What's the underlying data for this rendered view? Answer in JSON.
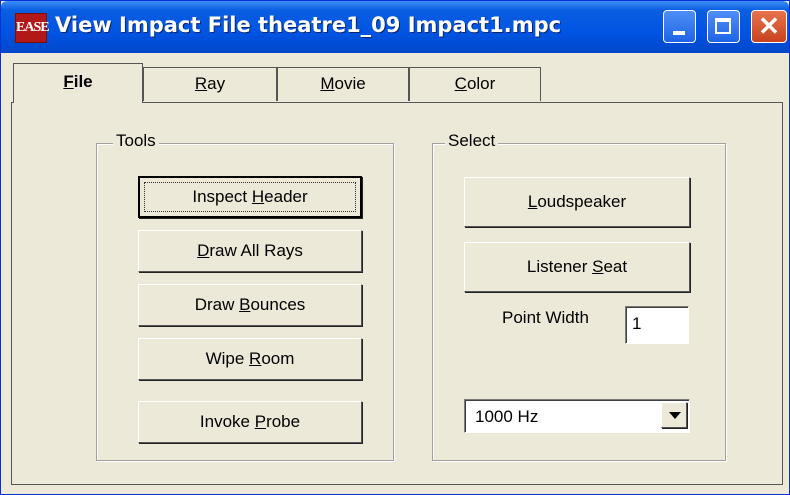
{
  "window": {
    "title": "View Impact File theatre1_09 Impact1.mpc",
    "icon_text": "EASE"
  },
  "tabs": [
    {
      "prefix": "",
      "mnemonic": "F",
      "suffix": "ile",
      "active": true
    },
    {
      "prefix": "",
      "mnemonic": "R",
      "suffix": "ay",
      "active": false
    },
    {
      "prefix": "",
      "mnemonic": "M",
      "suffix": "ovie",
      "active": false
    },
    {
      "prefix": "",
      "mnemonic": "C",
      "suffix": "olor",
      "active": false
    }
  ],
  "tools": {
    "legend": "Tools",
    "inspect_header": {
      "prefix": "Inspect ",
      "mnemonic": "H",
      "suffix": "eader"
    },
    "draw_all_rays": {
      "prefix": "",
      "mnemonic": "D",
      "suffix": "raw All Rays"
    },
    "draw_bounces": {
      "prefix": "Draw ",
      "mnemonic": "B",
      "suffix": "ounces"
    },
    "wipe_room": {
      "prefix": "Wipe ",
      "mnemonic": "R",
      "suffix": "oom"
    },
    "invoke_probe": {
      "prefix": "Invoke ",
      "mnemonic": "P",
      "suffix": "robe"
    }
  },
  "select": {
    "legend": "Select",
    "loudspeaker": {
      "prefix": "",
      "mnemonic": "L",
      "suffix": "oudspeaker"
    },
    "listener_seat": {
      "prefix": "Listener ",
      "mnemonic": "S",
      "suffix": "eat"
    },
    "point_width_label": "Point Width",
    "point_width_value": "1",
    "frequency_selected": "1000 Hz"
  },
  "colors": {
    "titlebar": "#0054e3",
    "face": "#ece9d8",
    "close": "#c9421e"
  }
}
